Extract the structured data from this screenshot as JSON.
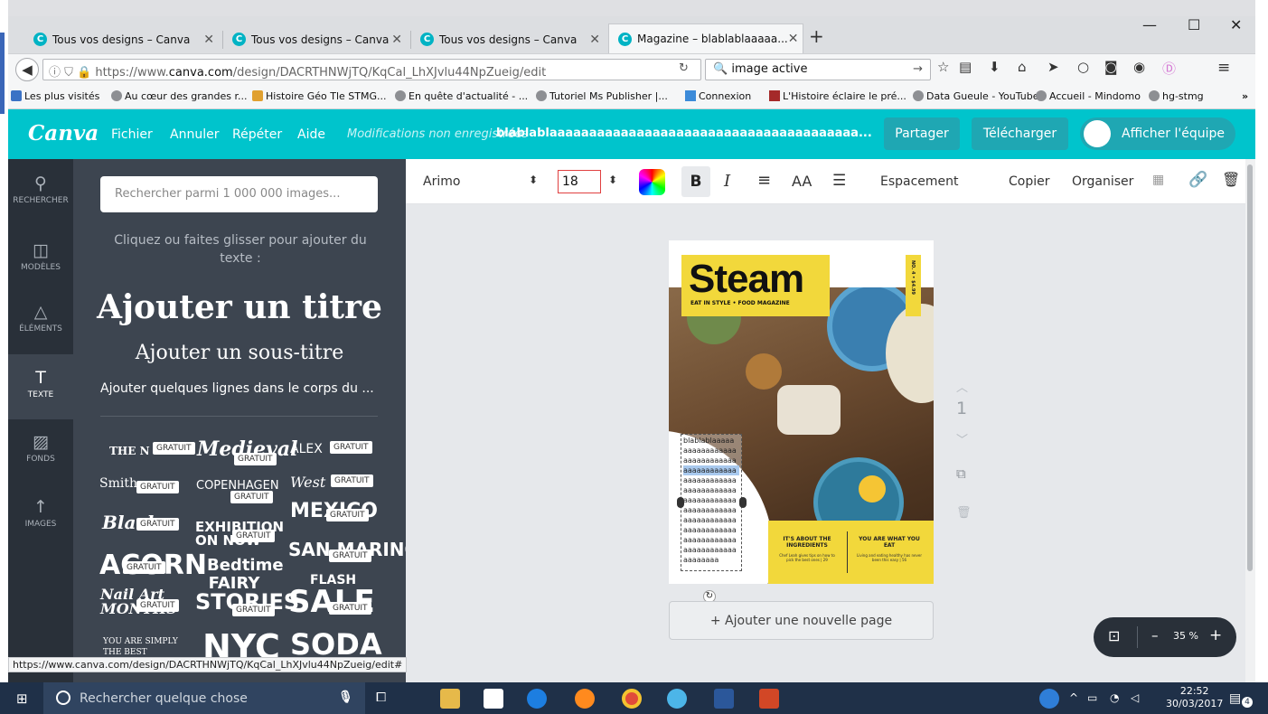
{
  "browser": {
    "tabs": [
      {
        "label": "Tous vos designs – Canva"
      },
      {
        "label": "Tous vos designs – Canva"
      },
      {
        "label": "Tous vos designs – Canva"
      },
      {
        "label": "Magazine – blablablaaaaa..."
      }
    ],
    "window_controls": {
      "minimize": "—",
      "maximize": "☐",
      "close": "✕"
    },
    "url_prefix": "https://www.",
    "url_domain": "canva.com",
    "url_rest": "/design/DACRTHNWjTQ/KqCal_LhXJvlu44NpZueig/edit",
    "search_value": "image active",
    "bookmarks": [
      "Les plus visités",
      "Au cœur des grandes r...",
      "Histoire Géo Tle STMG...",
      "En quête d'actualité - ...",
      "Tutoriel Ms Publisher |...",
      "Connexion",
      "L'Histoire éclaire le pré...",
      "Data Gueule - YouTube",
      "Accueil - Mindomo",
      "hg-stmg"
    ],
    "status_url": "https://www.canva.com/design/DACRTHNWjTQ/KqCal_LhXJvlu44NpZueig/edit#"
  },
  "canva": {
    "logo": "Canva",
    "menu": [
      "Fichier",
      "Annuler",
      "Répéter",
      "Aide"
    ],
    "status_text": "Modifications non enregistrées",
    "doc_title": "blablablaaaaaaaaaaaaaaaaaaaaaaaaaaaaaaaaaaaaaaa...",
    "share_label": "Partager",
    "download_label": "Télécharger",
    "team_label": "Afficher l'équipe",
    "rail": [
      {
        "icon": "search-icon",
        "label": "RECHERCHER"
      },
      {
        "icon": "templates-icon",
        "label": "MODÈLES"
      },
      {
        "icon": "elements-icon",
        "label": "ÉLÉMENTS"
      },
      {
        "icon": "text-icon",
        "label": "TEXTE"
      },
      {
        "icon": "backgrounds-icon",
        "label": "FONDS"
      },
      {
        "icon": "upload-icon",
        "label": "IMAGES"
      }
    ],
    "panel": {
      "search_placeholder": "Rechercher parmi 1 000 000 images...",
      "hint": "Cliquez ou faites glisser pour ajouter du texte :",
      "title": "Ajouter un titre",
      "subtitle": "Ajouter un sous-titre",
      "body": "Ajouter quelques lignes dans le corps du ...",
      "free_tag": "GRATUIT",
      "templates": [
        "THE N",
        "Medieval",
        "ALEX",
        "Smith",
        "COPENHAGEN",
        "West",
        "MEXICO",
        "Black",
        "EXHIBITION ON NOW",
        "SAN MARINO",
        "ACORN",
        "Bedtime FAIRY",
        "FLASH",
        "Nail Art MONTHS",
        "STORIES",
        "SALE",
        "YOU ARE SIMPLY THE BEST",
        "NYC",
        "SODA"
      ]
    },
    "toolbar": {
      "font": "Arimo",
      "size": "18",
      "bold": "B",
      "italic": "I",
      "align": "≡",
      "case": "AA",
      "list": "☰",
      "spacing": "Espacement",
      "copy": "Copier",
      "arrange": "Organiser"
    },
    "magazine": {
      "title": "Steam",
      "tagline": "EAT IN STYLE • FOOD MAGAZINE",
      "issue": "NO. 4 • $4.99",
      "col1_title": "IT'S ABOUT THE INGREDIENTS",
      "col1_text": "Chef Leah gives tips on how to pick the best ones | 29",
      "col2_title": "YOU ARE WHAT YOU EAT",
      "col2_text": "Living and eating healthy has never been this easy | 56",
      "textbox_lines": [
        "blablablaaaaa",
        "aaaaaaaaaaaa",
        "aaaaaaaaaaaa",
        "aaaaaaaaaaaa",
        "aaaaaaaaaaaa",
        "aaaaaaaaaaaa",
        "aaaaaaaaaaaa",
        "aaaaaaaaaaaa",
        "aaaaaaaaaaaa",
        "aaaaaaaaaaaa",
        "aaaaaaaaaaaa",
        "aaaaaaaaaaaa",
        "aaaaaaaa"
      ]
    },
    "page_number": "1",
    "add_page": "+ Ajouter une nouvelle page",
    "zoom": "35 %"
  },
  "taskbar": {
    "search_placeholder": "Rechercher quelque chose",
    "time": "22:52",
    "date": "30/03/2017",
    "notifications": "4"
  }
}
